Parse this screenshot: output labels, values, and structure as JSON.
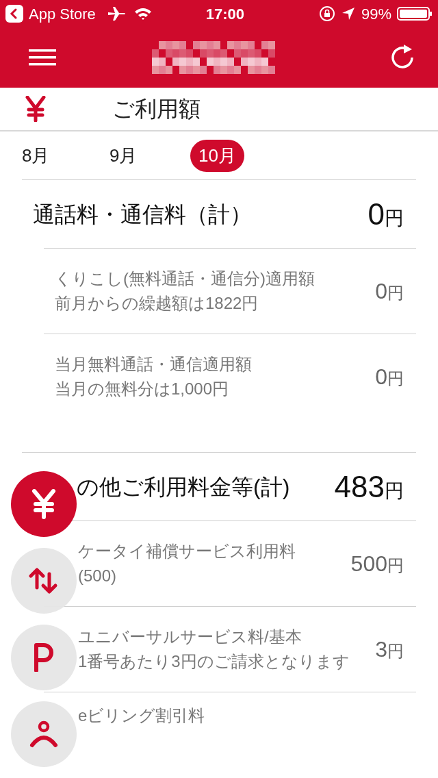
{
  "status_bar": {
    "back_label": "App Store",
    "time": "17:00",
    "battery": "99%"
  },
  "section": {
    "title": "ご利用額"
  },
  "months": [
    {
      "label": "8月",
      "selected": false
    },
    {
      "label": "9月",
      "selected": false
    },
    {
      "label": "10月",
      "selected": true
    }
  ],
  "groups": [
    {
      "label": "通話料・通信料（計）",
      "amount": "0",
      "unit": "円",
      "items": [
        {
          "lines": [
            "くりこし(無料通話・通信分)適用額",
            "前月からの繰越額は1822円"
          ],
          "amount": "0",
          "unit": "円"
        },
        {
          "lines": [
            "当月無料通話・通信適用額",
            "当月の無料分は1,000円"
          ],
          "amount": "0",
          "unit": "円"
        }
      ]
    },
    {
      "label": "の他ご利用料金等(計)",
      "amount": "483",
      "unit": "円",
      "items": [
        {
          "lines": [
            "ケータイ補償サービス利用料",
            "(500)"
          ],
          "amount": "500",
          "unit": "円"
        },
        {
          "lines": [
            "ユニバーサルサービス料/基本",
            "1番号あたり3円のご請求となります"
          ],
          "amount": "3",
          "unit": "円"
        },
        {
          "lines": [
            "eビリング割引料"
          ]
        }
      ]
    }
  ],
  "fabs": [
    {
      "kind": "yen",
      "selected": true
    },
    {
      "kind": "transfer",
      "selected": false
    },
    {
      "kind": "point",
      "selected": false
    },
    {
      "kind": "person",
      "selected": false
    }
  ]
}
